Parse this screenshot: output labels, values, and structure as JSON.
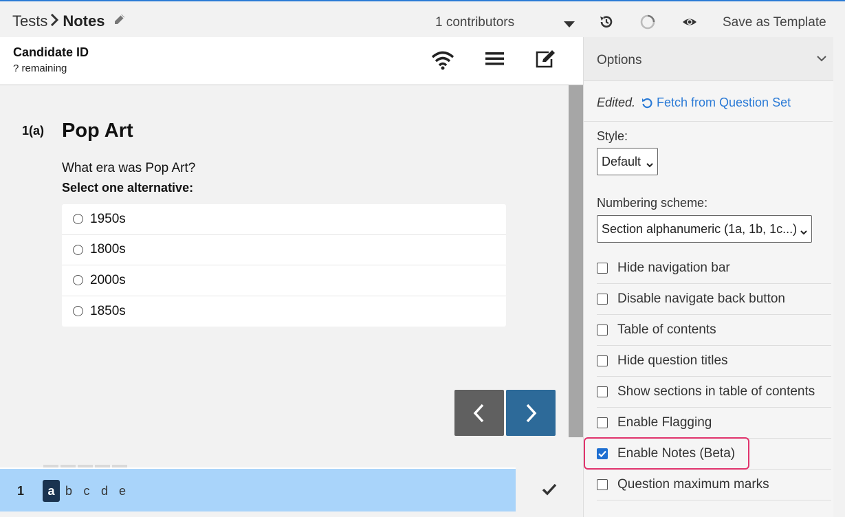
{
  "header": {
    "breadcrumb_root": "Tests",
    "breadcrumb_current": "Notes",
    "contributors": "1 contributors",
    "save_template": "Save as Template"
  },
  "preview": {
    "candidate_id": "Candidate ID",
    "remaining": "? remaining",
    "question_number": "1(a)",
    "question_title": "Pop Art",
    "question_text": "What era was Pop Art?",
    "instruction": "Select one alternative:",
    "alternatives": [
      "1950s",
      "1800s",
      "2000s",
      "1850s"
    ]
  },
  "bottom_nav": {
    "section_number": "1",
    "letters": [
      "a",
      "b",
      "c",
      "d",
      "e"
    ],
    "active_letter": "a"
  },
  "options": {
    "title": "Options",
    "edited": "Edited.",
    "fetch_link": "Fetch from Question Set",
    "style_label": "Style:",
    "style_value": "Default",
    "numbering_label": "Numbering scheme:",
    "numbering_value": "Section alphanumeric (1a, 1b, 1c...)",
    "checkboxes": [
      {
        "label": "Hide navigation bar",
        "checked": false
      },
      {
        "label": "Disable navigate back button",
        "checked": false
      },
      {
        "label": "Table of contents",
        "checked": false
      },
      {
        "label": "Hide question titles",
        "checked": false
      },
      {
        "label": "Show sections in table of contents",
        "checked": false
      },
      {
        "label": "Enable Flagging",
        "checked": false
      },
      {
        "label": "Enable Notes (Beta)",
        "checked": true
      },
      {
        "label": "Question maximum marks",
        "checked": false
      }
    ]
  },
  "colors": {
    "accent": "#2a7ad6",
    "next_button": "#2d6a99",
    "prev_button": "#606060",
    "bottom_bar": "#a9d4fa",
    "highlight": "#e0336c"
  }
}
